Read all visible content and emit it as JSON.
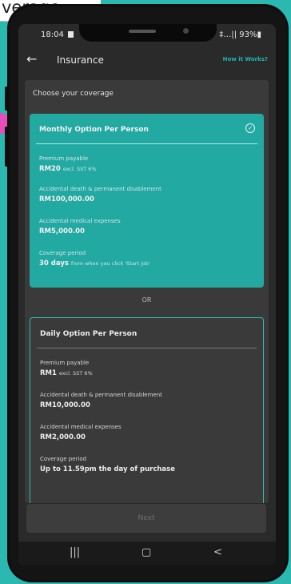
{
  "slide_label": "verage",
  "status_bar": {
    "time": "18:04",
    "right": "‡…|| 93%▮"
  },
  "app_bar": {
    "back": "←",
    "title": "Insurance",
    "help": "How it Works?"
  },
  "section_title": "Choose your coverage",
  "monthly": {
    "title": "Monthly Option Per Person",
    "check": "✓",
    "premium_label": "Premium payable",
    "premium_value": "RM20",
    "premium_sub": "excl. SST 6%",
    "death_label": "Accidental death & permanent disablement",
    "death_value": "RM100,000.00",
    "medical_label": "Accidental medical expenses",
    "medical_value": "RM5,000.00",
    "period_label": "Coverage period",
    "period_value": "30 days",
    "period_sub": "from when you click 'Start job'"
  },
  "or_label": "OR",
  "daily": {
    "title": "Daily Option Per Person",
    "premium_label": "Premium payable",
    "premium_value": "RM1",
    "premium_sub": "excl. SST 6%",
    "death_label": "Accidental death & permanent disablement",
    "death_value": "RM10,000.00",
    "medical_label": "Accidental medical expenses",
    "medical_value": "RM2,000.00",
    "period_label": "Coverage period",
    "period_value": "Up to 11.59pm the day of purchase"
  },
  "next_label": "Next",
  "nav": {
    "recent": "|||",
    "home": "▢",
    "back": "<"
  }
}
